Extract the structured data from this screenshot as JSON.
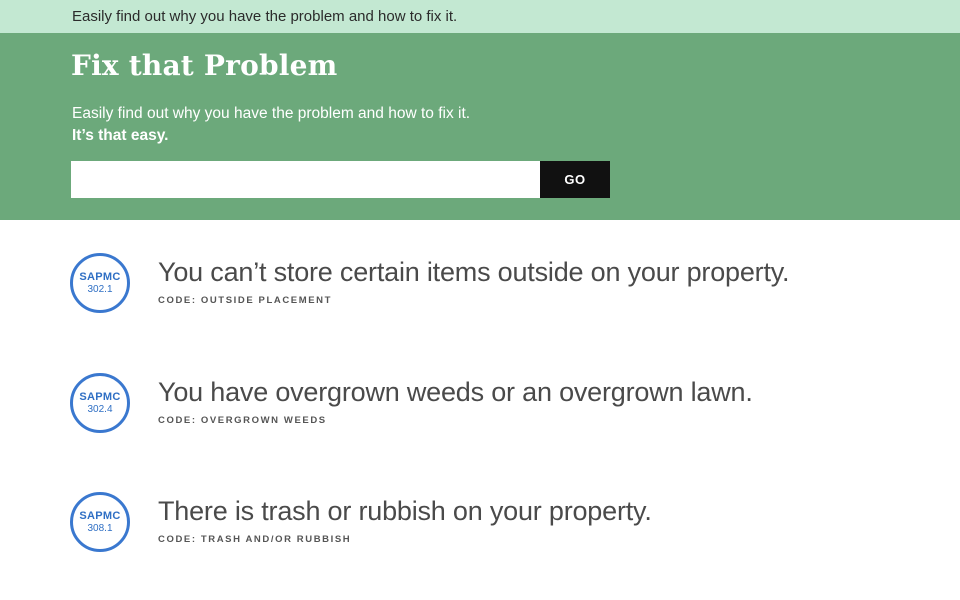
{
  "topbar": {
    "text": "Easily find out why you have the problem and how to fix it."
  },
  "hero": {
    "title": "Fix that Problem",
    "description": "Easily find out why you have the problem and how to fix it.",
    "tagline": "It’s that easy.",
    "search": {
      "value": "",
      "placeholder": ""
    },
    "go_label": "GO"
  },
  "problems": [
    {
      "badge_top": "SAPMC",
      "badge_bottom": "302.1",
      "title": "You can’t store certain items outside on your property.",
      "code": "CODE: OUTSIDE PLACEMENT"
    },
    {
      "badge_top": "SAPMC",
      "badge_bottom": "302.4",
      "title": "You have overgrown weeds or an overgrown lawn.",
      "code": "CODE: OVERGROWN WEEDS"
    },
    {
      "badge_top": "SAPMC",
      "badge_bottom": "308.1",
      "title": "There is trash or rubbish on your property.",
      "code": "CODE: TRASH AND/OR RUBBISH"
    }
  ],
  "colors": {
    "topbar_bg": "#c3e8d2",
    "hero_bg": "#6ca97b",
    "badge_blue": "#3a78cf",
    "button_bg": "#111111"
  }
}
